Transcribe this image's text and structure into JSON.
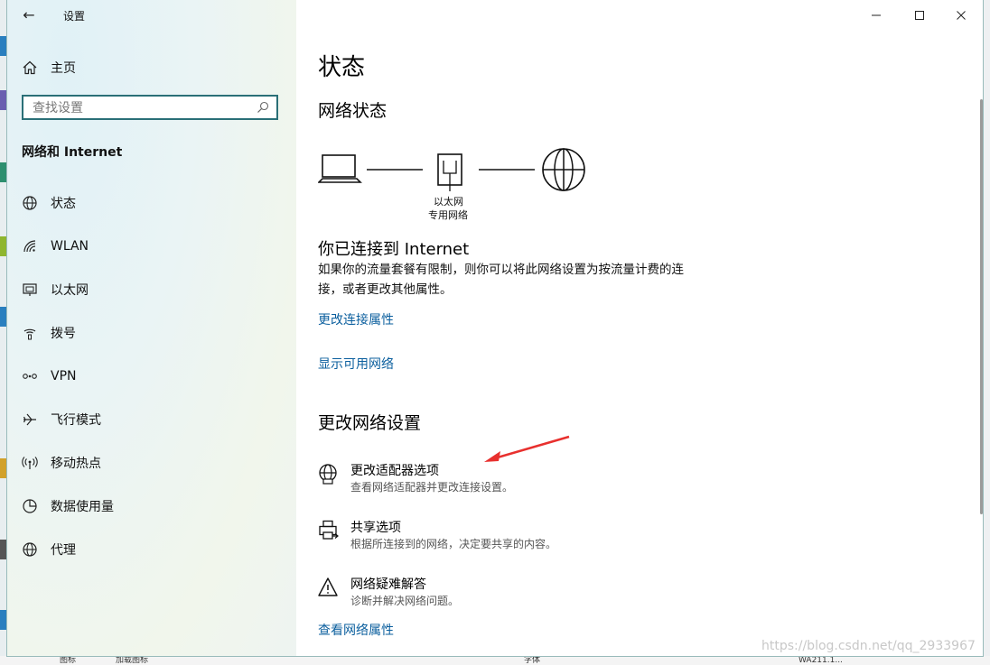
{
  "app": {
    "title": "设置",
    "back_glyph": "←"
  },
  "window_controls": {
    "minimize": "—",
    "maximize": "☐",
    "close": "✕"
  },
  "sidebar": {
    "home_label": "主页",
    "search_placeholder": "查找设置",
    "section_title": "网络和 Internet",
    "items": [
      {
        "label": "状态",
        "icon": "globe-icon"
      },
      {
        "label": "WLAN",
        "icon": "wifi-icon"
      },
      {
        "label": "以太网",
        "icon": "ethernet-icon"
      },
      {
        "label": "拨号",
        "icon": "dialup-icon"
      },
      {
        "label": "VPN",
        "icon": "vpn-icon"
      },
      {
        "label": "飞行模式",
        "icon": "airplane-icon"
      },
      {
        "label": "移动热点",
        "icon": "hotspot-icon"
      },
      {
        "label": "数据使用量",
        "icon": "data-usage-icon"
      },
      {
        "label": "代理",
        "icon": "proxy-icon"
      }
    ]
  },
  "main": {
    "page_title": "状态",
    "network_status_heading": "网络状态",
    "diagram": {
      "adapter_label": "以太网",
      "network_type": "专用网络"
    },
    "connected_title": "你已连接到 Internet",
    "connected_desc": "如果你的流量套餐有限制，则你可以将此网络设置为按流量计费的连接，或者更改其他属性。",
    "links": {
      "change_connection_properties": "更改连接属性",
      "show_available_networks": "显示可用网络"
    },
    "change_settings_heading": "更改网络设置",
    "options": [
      {
        "title": "更改适配器选项",
        "desc": "查看网络适配器并更改连接设置。",
        "icon": "adapter-globe-icon"
      },
      {
        "title": "共享选项",
        "desc": "根据所连接到的网络，决定要共享的内容。",
        "icon": "sharing-printer-icon"
      },
      {
        "title": "网络疑难解答",
        "desc": "诊断并解决网络问题。",
        "icon": "warning-icon"
      }
    ],
    "view_network_properties": "查看网络属性"
  },
  "annotation": {
    "arrow_color": "#e8302e"
  },
  "watermark": "https://blog.csdn.net/qq_2933967",
  "desktop": {
    "bottom_texts": [
      "图标",
      "加载图标",
      "字体",
      "WA211.1..."
    ]
  },
  "colors": {
    "link": "#0b5f9e",
    "search_border": "#2a6f77"
  }
}
